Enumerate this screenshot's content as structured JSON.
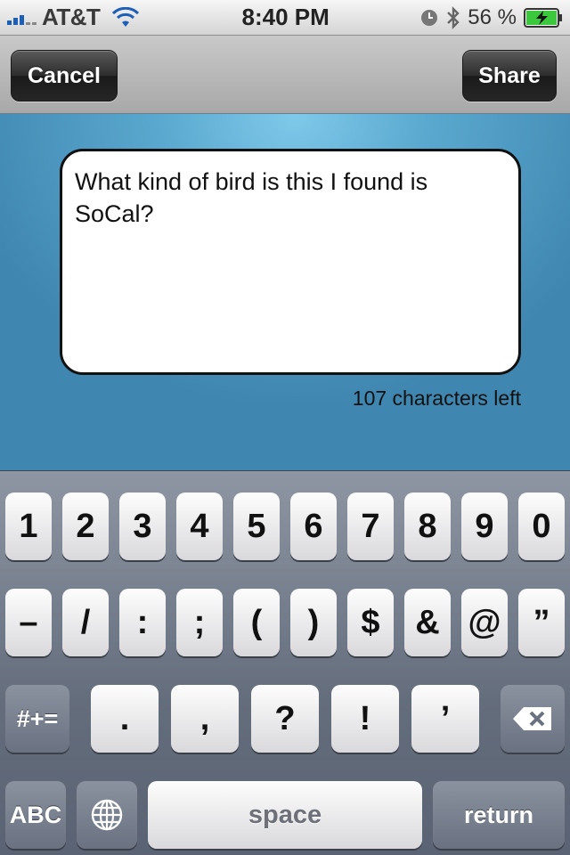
{
  "status_bar": {
    "carrier": "AT&T",
    "time": "8:40 PM",
    "battery_percent": "56 %",
    "icons": [
      "signal-icon",
      "wifi-icon",
      "clock-icon",
      "bluetooth-icon",
      "battery-charging-icon"
    ]
  },
  "nav": {
    "cancel_label": "Cancel",
    "share_label": "Share"
  },
  "compose": {
    "text": "What kind of bird is this I found is SoCal?",
    "char_count_label": "107 characters left"
  },
  "keyboard": {
    "row1": [
      "1",
      "2",
      "3",
      "4",
      "5",
      "6",
      "7",
      "8",
      "9",
      "0"
    ],
    "row2": [
      "–",
      "/",
      ":",
      ";",
      "(",
      ")",
      "$",
      "&",
      "@",
      "”"
    ],
    "row3_mode": "#+=",
    "row3": [
      ".",
      ",",
      "?",
      "!",
      "’"
    ],
    "abc_label": "ABC",
    "space_label": "space",
    "return_label": "return",
    "icons": [
      "globe-icon",
      "delete-icon"
    ]
  },
  "colors": {
    "accent_blue": "#1d5fb6",
    "battery_green": "#3cc83c"
  }
}
